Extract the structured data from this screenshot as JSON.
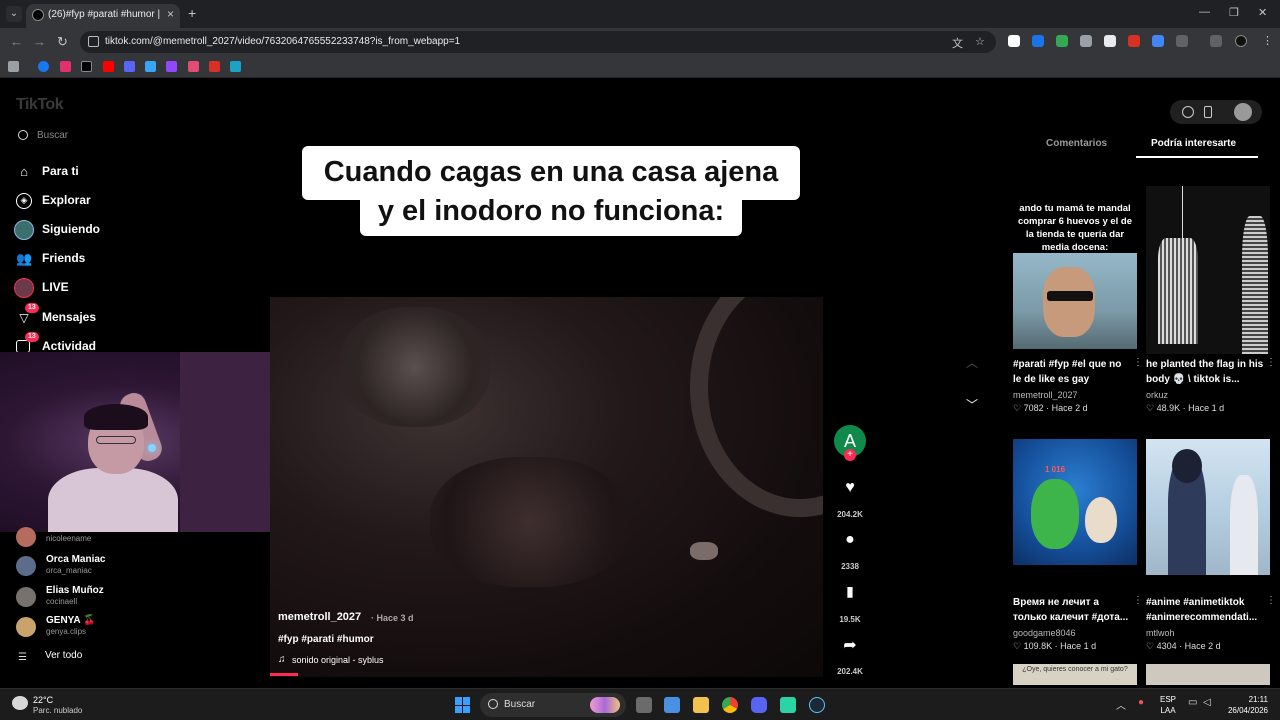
{
  "browser": {
    "tab_title": "(26)#fyp #parati #humor | ",
    "url": "tiktok.com/@memetroll_2027/video/7632064765552233748?is_from_webapp=1"
  },
  "sidebar": {
    "logo": "TikTok",
    "search_placeholder": "Buscar",
    "items": [
      {
        "label": "Para ti",
        "icon": "home-icon"
      },
      {
        "label": "Explorar",
        "icon": "compass-icon"
      },
      {
        "label": "Siguiendo",
        "icon": "following-avatar-icon"
      },
      {
        "label": "Friends",
        "icon": "friends-icon"
      },
      {
        "label": "LIVE",
        "icon": "live-icon"
      },
      {
        "label": "Mensajes",
        "icon": "messages-icon",
        "badge": "13"
      },
      {
        "label": "Actividad",
        "icon": "activity-icon",
        "badge": "13"
      }
    ],
    "following": [
      {
        "name": "",
        "handle": "nicoleename"
      },
      {
        "name": "Orca Maniac",
        "handle": "orca_maniac"
      },
      {
        "name": "Elias Muñoz",
        "handle": "cocinaell"
      },
      {
        "name": "GENYA 🍒",
        "handle": "genya.clips"
      }
    ],
    "see_all": "Ver todo"
  },
  "video": {
    "caption_line1": "Cuando cagas en una casa ajena",
    "caption_line2": "y el inodoro no funciona:",
    "author": "memetroll_2027",
    "time": "· Hace 3 d",
    "hashtags": "#fyp #parati #humor",
    "music": "sonido original - syblus",
    "progress": 0.05
  },
  "actions": {
    "avatar_letter": "A",
    "likes": "204.2K",
    "comments": "2338",
    "saves": "19.5K",
    "shares": "202.4K"
  },
  "right_panel": {
    "tab_comments": "Comentarios",
    "tab_related": "Podría interesarte",
    "cards": [
      {
        "meme_text": [
          "ando tu mamá te mandal",
          "comprar 6 huevos y el de",
          "la tienda te quería dar",
          "media docena:"
        ],
        "title": "#parati #fyp #el que no le de like es gay",
        "author": "memetroll_2027",
        "stats": "♡ 7082 · Hace 2 d"
      },
      {
        "title": "he planted the flag in his body 💀 \\ tiktok is...",
        "author": "orkuz",
        "stats": "♡ 48.9K · Hace 1 d"
      },
      {
        "overlay": "1 016",
        "title": "Время не лечит а только калечит #дота...",
        "author": "goodgame8046",
        "stats": "♡ 109.8K · Hace 1 d"
      },
      {
        "title": "#anime #animetiktok #animerecommendati...",
        "author": "mtlwoh",
        "stats": "♡ 4304 · Hace 2 d"
      }
    ],
    "peek_text": "¿Oye, quieres conocer a mi gato?"
  },
  "taskbar": {
    "temp": "22°C",
    "weather": "Parc. nublado",
    "search": "Buscar",
    "lang_line1": "ESP",
    "lang_line2": "LAA",
    "time": "21:11",
    "date": "26/04/2026"
  },
  "colors": {
    "accent": "#fe2c55",
    "background": "#000000",
    "chrome": "#35363a"
  }
}
